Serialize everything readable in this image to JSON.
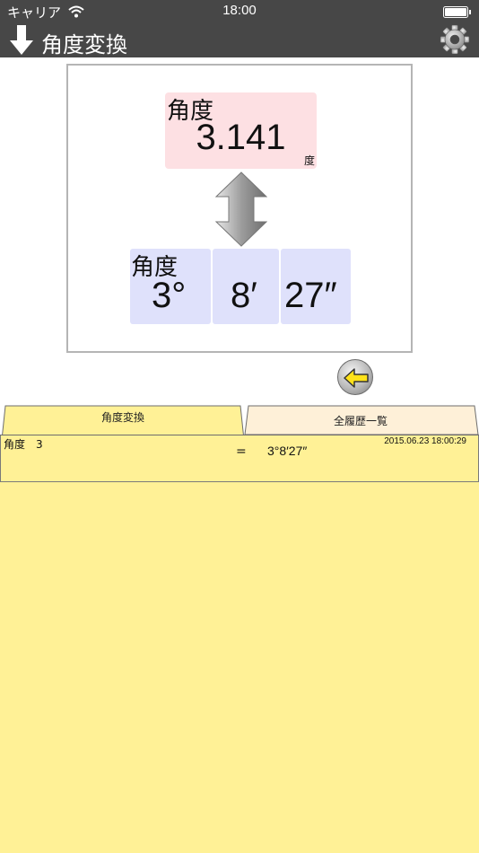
{
  "status": {
    "carrier": "キャリア",
    "time": "18:00"
  },
  "nav": {
    "title": "角度変換"
  },
  "converter": {
    "degree_label": "角度",
    "degree_value": "3.141",
    "degree_unit": "度",
    "dms_label": "角度",
    "dms_degrees": "3°",
    "dms_minutes": "8′",
    "dms_seconds": "27″"
  },
  "tabs": [
    {
      "label": "角度変換"
    },
    {
      "label": "全履歴一覧"
    }
  ],
  "history": [
    {
      "input": "角度　3",
      "equals": "=",
      "result": "3°8′27″",
      "timestamp": "2015.06.23 18:00:29"
    }
  ],
  "colors": {
    "nav_bg": "#474747",
    "degree_box": "#fde0e3",
    "dms_box": "#dfe1fb",
    "active_tab": "#fff196",
    "inactive_tab": "#fef0d8"
  }
}
